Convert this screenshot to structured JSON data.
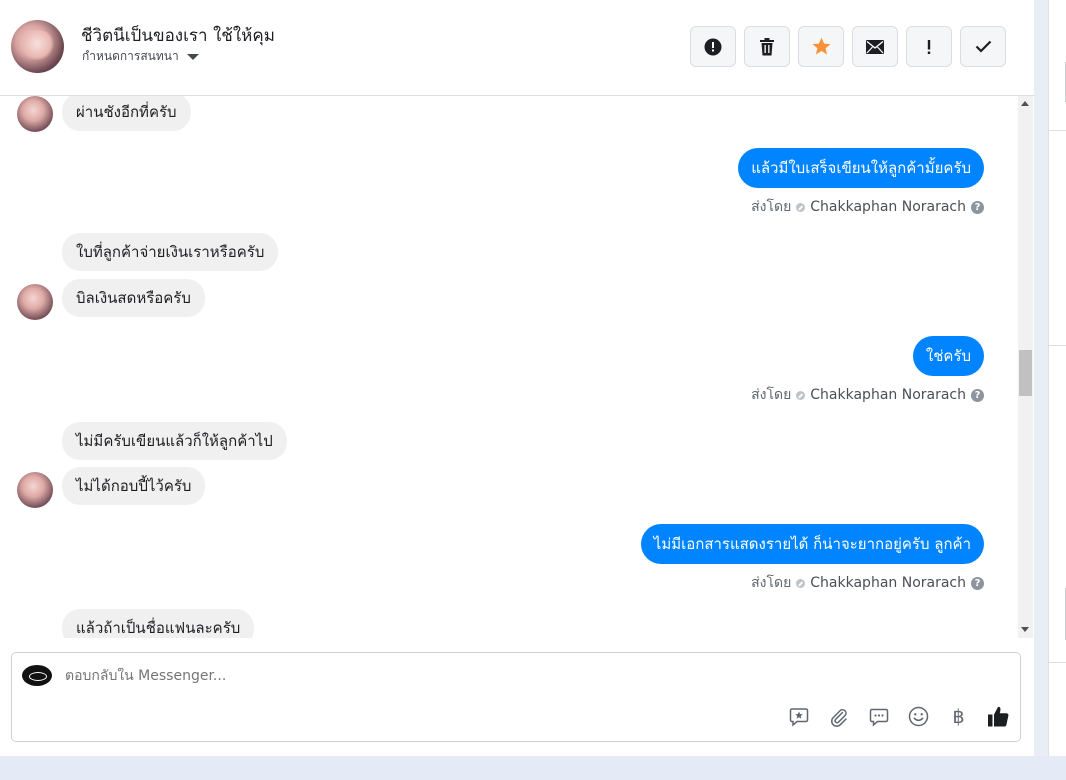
{
  "header": {
    "title": "ชีวิตนีเป็นของเรา ใช้ให้คุม",
    "subtitle": "กำหนดการสนทนา"
  },
  "actions": [
    {
      "icon": "alert-circle-icon"
    },
    {
      "icon": "trash-icon"
    },
    {
      "icon": "star-icon",
      "color": "#f7923b"
    },
    {
      "icon": "envelope-icon"
    },
    {
      "icon": "exclamation-icon"
    },
    {
      "icon": "check-icon"
    }
  ],
  "messages": [
    {
      "direction": "in",
      "text": "ผ่านชังอีกที่ครับ"
    },
    {
      "direction": "out",
      "text": "แล้วมีใบเสร็จเขียนให้ลูกค้ามั้ยครับ",
      "sent_label": "ส่งโดย",
      "sender": "Chakkaphan Norarach"
    },
    {
      "direction": "in",
      "text": "ใบที่ลูกค้าจ่ายเงินเราหรือครับ"
    },
    {
      "direction": "in",
      "text": "บิลเงินสดหรือครับ"
    },
    {
      "direction": "out",
      "text": "ใช่ครับ",
      "sent_label": "ส่งโดย",
      "sender": "Chakkaphan Norarach"
    },
    {
      "direction": "in",
      "text": "ไม่มีครับเขียนแล้วก็ให้ลูกค้าไป"
    },
    {
      "direction": "in",
      "text": "ไม่ได้กอบปี้ไว้ครับ"
    },
    {
      "direction": "out",
      "text": "ไม่มีเอกสารแสดงรายได้ ก็น่าจะยากอยู่ครับ ลูกค้า",
      "sent_label": "ส่งโดย",
      "sender": "Chakkaphan Norarach"
    },
    {
      "direction": "in",
      "text": "แล้วถ้าเป็นชื่อแฟนละครับ"
    }
  ],
  "composer": {
    "placeholder": "ตอบกลับใน Messenger...",
    "tools": [
      "saved-reply-icon",
      "paperclip-icon",
      "chat-bubble-icon",
      "smiley-icon",
      "baht-icon",
      "thumbs-up-icon"
    ],
    "baht_symbol": "฿"
  },
  "colors": {
    "accent": "#0084ff",
    "incoming_bubble": "#f1f0f0",
    "star": "#f7923b"
  }
}
